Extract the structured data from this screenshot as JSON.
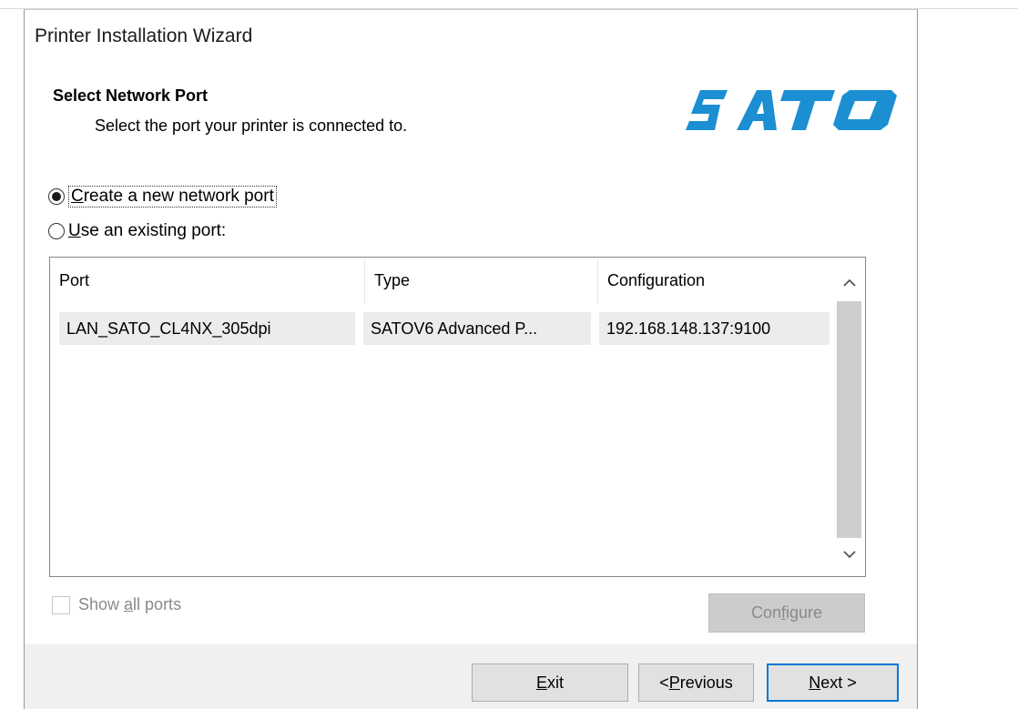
{
  "window": {
    "title": "Printer Installation Wizard"
  },
  "header": {
    "title": "Select Network Port",
    "subtitle": "Select the port your printer is connected to.",
    "logo_text": "SATO",
    "logo_color": "#1b8fd2"
  },
  "options": {
    "create_new": {
      "prefix": "",
      "accel": "C",
      "rest": "reate a new network port",
      "selected": true
    },
    "use_existing": {
      "prefix": "",
      "accel": "U",
      "rest": "se an existing port:",
      "selected": false
    }
  },
  "port_table": {
    "columns": [
      "Port",
      "Type",
      "Configuration"
    ],
    "rows": [
      {
        "port": "LAN_SATO_CL4NX_305dpi",
        "type": "SATOV6 Advanced P...",
        "configuration": "192.168.148.137:9100"
      }
    ]
  },
  "show_all_ports": {
    "prefix": "Show ",
    "accel": "a",
    "rest": "ll ports",
    "checked": false,
    "enabled": false
  },
  "configure_button": {
    "prefix": "Con",
    "accel": "f",
    "rest": "igure",
    "enabled": false
  },
  "footer": {
    "exit": {
      "accel": "E",
      "rest": "xit"
    },
    "previous": {
      "prefix": "< ",
      "accel": "P",
      "rest": "revious"
    },
    "next": {
      "accel": "N",
      "rest": "ext >"
    }
  }
}
